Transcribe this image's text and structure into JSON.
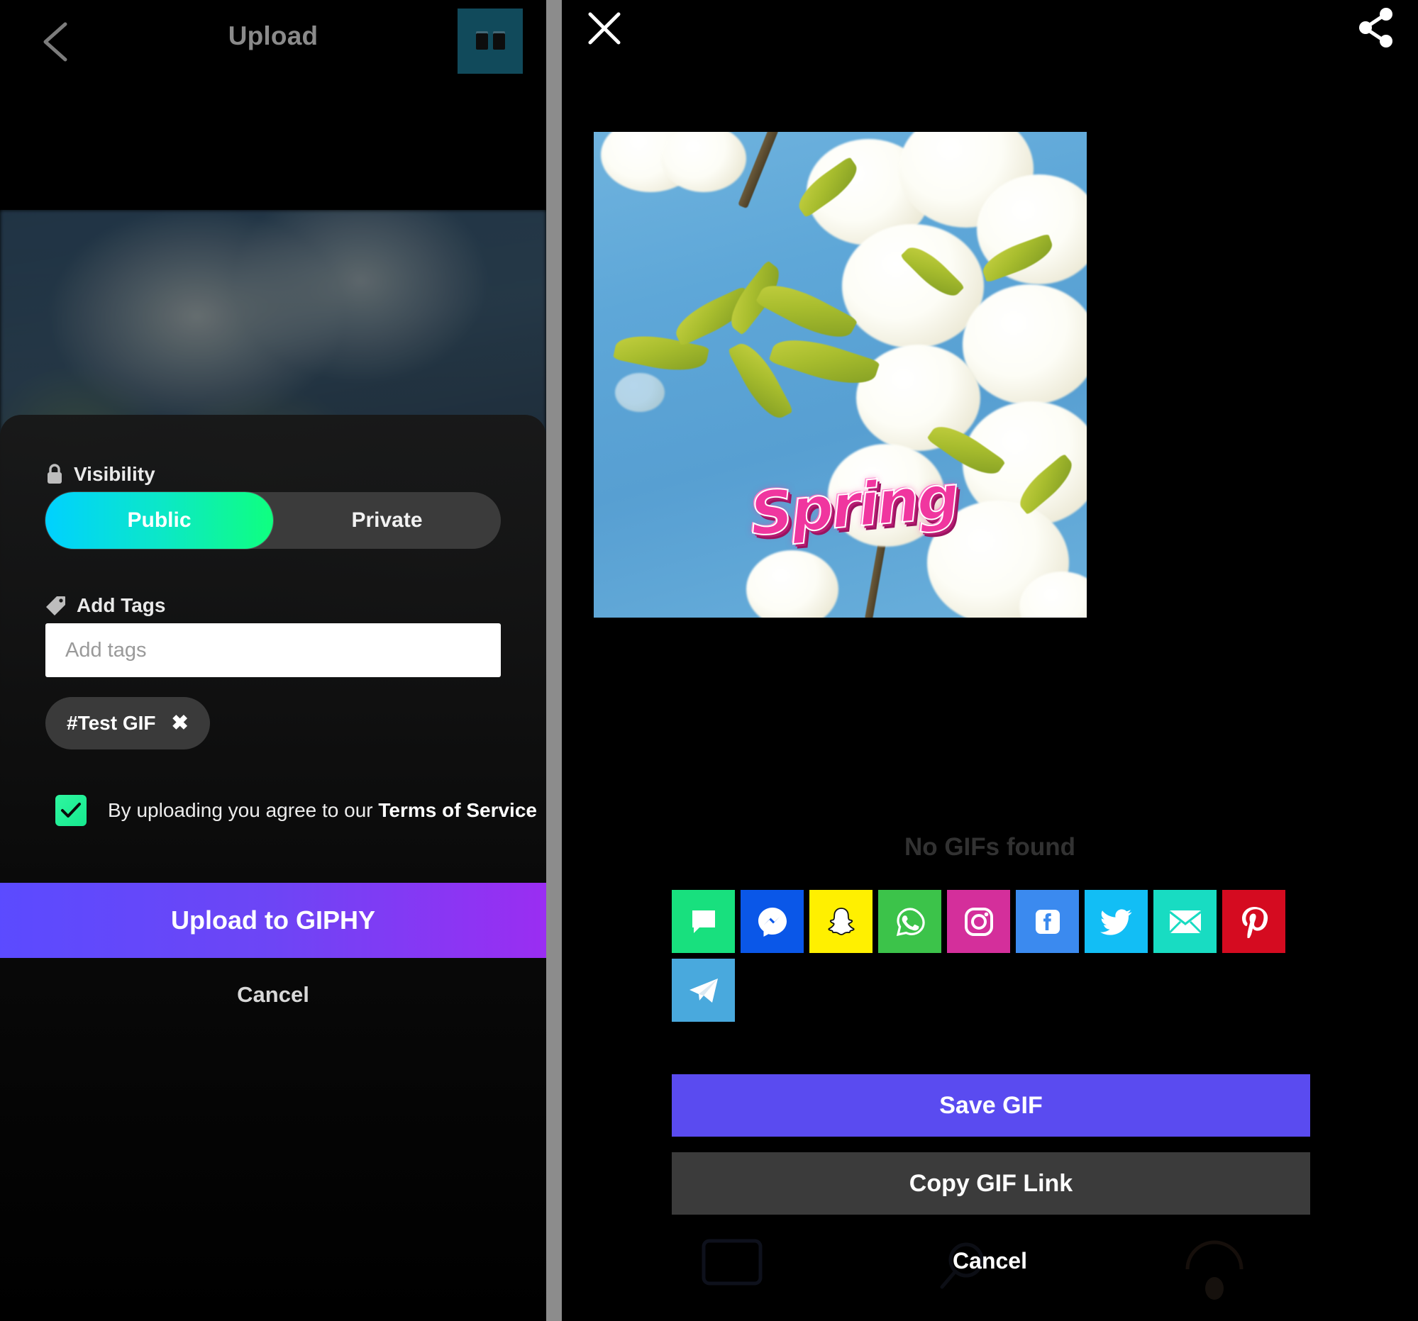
{
  "upload_screen": {
    "header": {
      "back_icon": "chevron-left-icon",
      "title": "Upload",
      "thumbnail_icon": "gif-thumbnail"
    },
    "visibility": {
      "icon": "lock-icon",
      "label": "Visibility",
      "options": [
        "Public",
        "Private"
      ],
      "selected": "Public",
      "active_gradient_from": "#00d1ff",
      "active_gradient_to": "#0fff7f"
    },
    "tags": {
      "icon": "tag-icon",
      "label": "Add Tags",
      "input_value": "",
      "input_placeholder": "Add tags",
      "chips": [
        {
          "label": "#Test GIF",
          "remove_icon": "close-icon"
        }
      ]
    },
    "terms": {
      "checked": true,
      "text_prefix": "By uploading you agree to our ",
      "link_label": "Terms of Service",
      "checkbox_color": "#20eb92"
    },
    "actions": {
      "primary_label": "Upload to GIPHY",
      "primary_gradient_from": "#5b4bff",
      "primary_gradient_to": "#9b2df2",
      "cancel_label": "Cancel"
    }
  },
  "share_screen": {
    "header": {
      "close_icon": "close-icon",
      "share_icon": "share-icon"
    },
    "preview": {
      "alt": "cherry blossom gif",
      "overlay_text": "Spring",
      "overlay_color": "#f0369f"
    },
    "background_text": "No GIFs found",
    "share_targets": [
      {
        "name": "Messages",
        "icon": "message-bubble-icon",
        "color": "#18e07e"
      },
      {
        "name": "Messenger",
        "icon": "messenger-icon",
        "color": "#0a57e8"
      },
      {
        "name": "Snapchat",
        "icon": "snapchat-ghost-icon",
        "color": "#fff000"
      },
      {
        "name": "WhatsApp",
        "icon": "whatsapp-icon",
        "color": "#3cc34a"
      },
      {
        "name": "Instagram",
        "icon": "instagram-icon",
        "color": "#d42f9b"
      },
      {
        "name": "Facebook",
        "icon": "facebook-icon",
        "color": "#3b8aef"
      },
      {
        "name": "Twitter",
        "icon": "twitter-bird-icon",
        "color": "#12bef5"
      },
      {
        "name": "Email",
        "icon": "envelope-icon",
        "color": "#18dcc2"
      },
      {
        "name": "Pinterest",
        "icon": "pinterest-icon",
        "color": "#d50b20"
      },
      {
        "name": "Telegram",
        "icon": "telegram-plane-icon",
        "color": "#49a9dd"
      }
    ],
    "actions": {
      "save_label": "Save GIF",
      "save_color": "#5a4bf0",
      "copy_link_label": "Copy GIF Link",
      "copy_link_color": "#3b3b3b",
      "cancel_label": "Cancel"
    },
    "tab_bar_icons": [
      "gif-tab-icon",
      "search-tab-icon",
      "camera-tab-icon"
    ]
  }
}
